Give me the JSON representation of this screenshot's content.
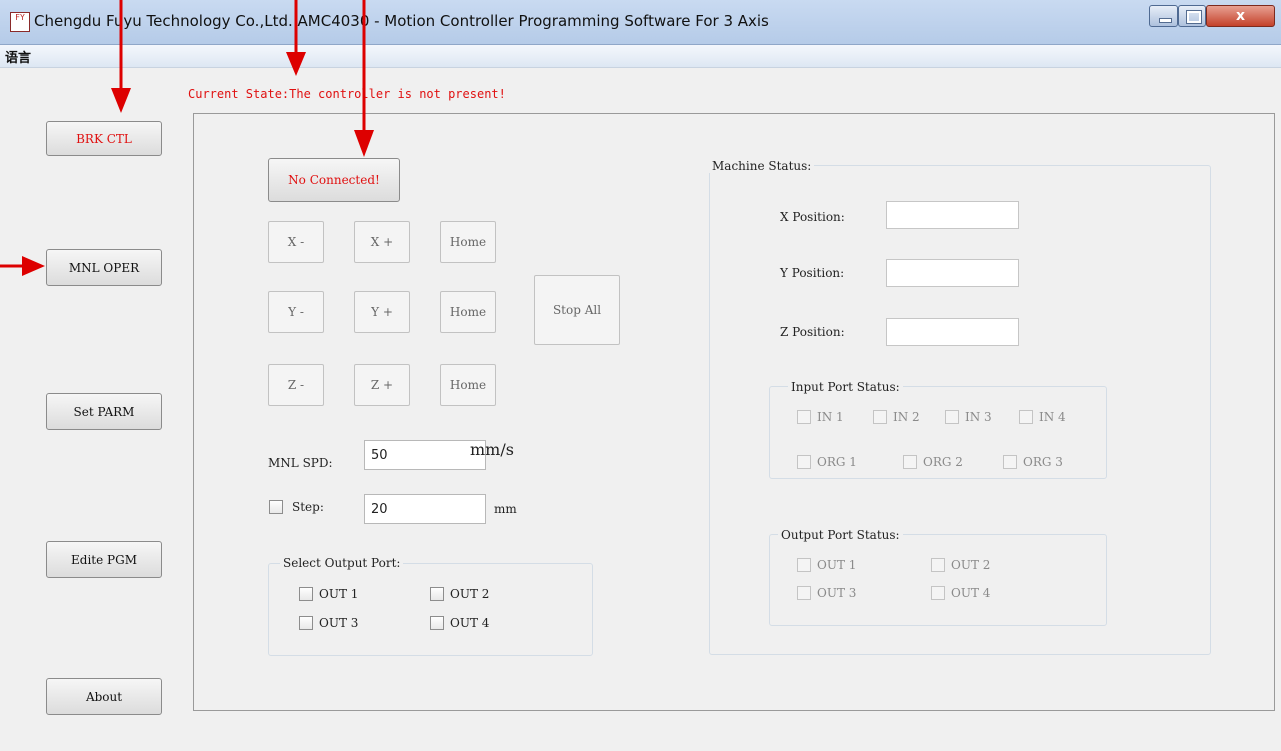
{
  "window": {
    "icon_text": "FY",
    "title": "Chengdu Fuyu Technology Co.,Ltd.  AMC4030 -  Motion Controller Programming Software For 3 Axis",
    "close_glyph": "x"
  },
  "menu": {
    "language": "语言"
  },
  "status": {
    "current_state": "Current State:The controller is not present!"
  },
  "sidebar": {
    "brk_ctl": "BRK CTL",
    "mnl_oper": "MNL OPER",
    "set_parm": "Set PARM",
    "edit_pgm": "Edite PGM",
    "about": "About"
  },
  "manual": {
    "connect_button": "No Connected!",
    "x_minus": "X -",
    "x_plus": "X +",
    "x_home": "Home",
    "y_minus": "Y -",
    "y_plus": "Y +",
    "y_home": "Home",
    "z_minus": "Z -",
    "z_plus": "Z +",
    "z_home": "Home",
    "stop_all": "Stop All",
    "speed_label": "MNL SPD:",
    "speed_value": "50",
    "speed_unit": "mm/s",
    "step_label": "Step:",
    "step_value": "20",
    "step_unit": "mm",
    "output_group_title": "Select Output Port:",
    "outputs": [
      "OUT 1",
      "OUT 2",
      "OUT 3",
      "OUT 4"
    ]
  },
  "machine_status": {
    "title": "Machine Status:",
    "x_label": "X Position:",
    "y_label": "Y Position:",
    "z_label": "Z Position:",
    "x_value": "",
    "y_value": "",
    "z_value": "",
    "input_title": "Input Port Status:",
    "inputs": [
      "IN 1",
      "IN 2",
      "IN 3",
      "IN 4"
    ],
    "origins": [
      "ORG 1",
      "ORG 2",
      "ORG 3"
    ],
    "output_title": "Output Port Status:",
    "outputs": [
      "OUT 1",
      "OUT 2",
      "OUT 3",
      "OUT 4"
    ]
  },
  "colors": {
    "alert_red": "#e01010",
    "annotation_arrow": "#dd0000",
    "titlebar": "#c9daf1"
  }
}
